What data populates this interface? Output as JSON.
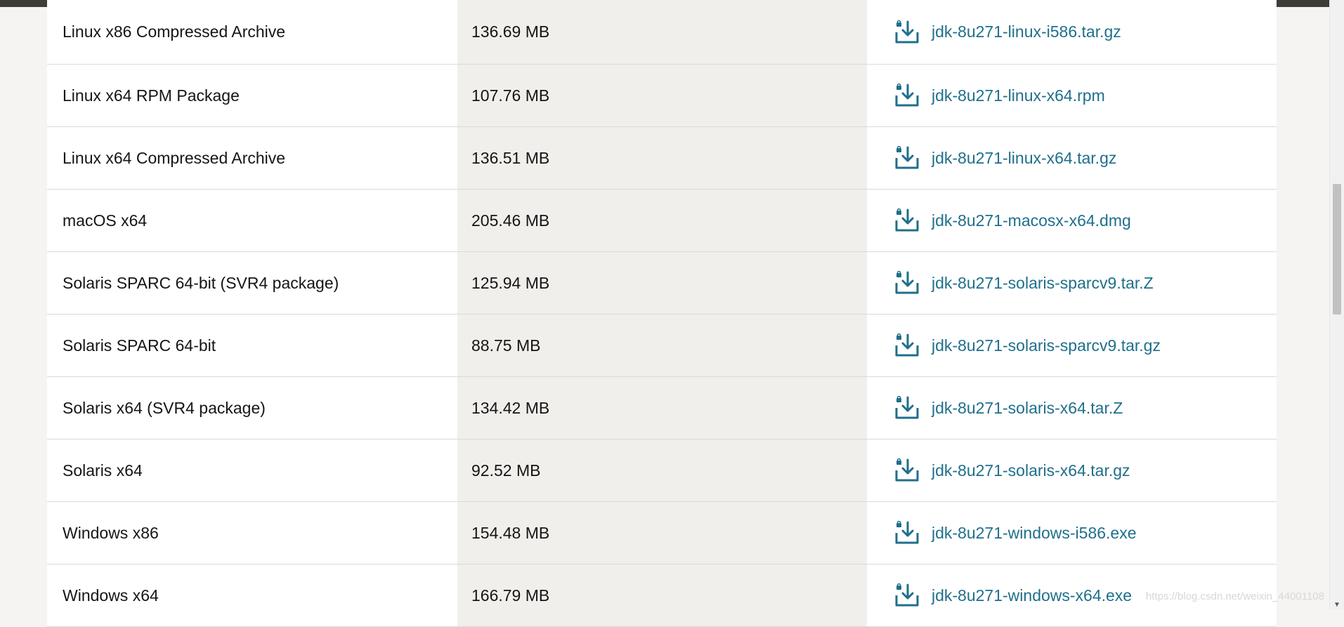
{
  "rows": [
    {
      "product": "Linux x86 Compressed Archive",
      "size": "136.69 MB",
      "file": "jdk-8u271-linux-i586.tar.gz"
    },
    {
      "product": "Linux x64 RPM Package",
      "size": "107.76 MB",
      "file": "jdk-8u271-linux-x64.rpm"
    },
    {
      "product": "Linux x64 Compressed Archive",
      "size": "136.51 MB",
      "file": "jdk-8u271-linux-x64.tar.gz"
    },
    {
      "product": "macOS x64",
      "size": "205.46 MB",
      "file": "jdk-8u271-macosx-x64.dmg"
    },
    {
      "product": "Solaris SPARC 64-bit (SVR4 package)",
      "size": "125.94 MB",
      "file": "jdk-8u271-solaris-sparcv9.tar.Z"
    },
    {
      "product": "Solaris SPARC 64-bit",
      "size": "88.75 MB",
      "file": "jdk-8u271-solaris-sparcv9.tar.gz"
    },
    {
      "product": "Solaris x64 (SVR4 package)",
      "size": "134.42 MB",
      "file": "jdk-8u271-solaris-x64.tar.Z"
    },
    {
      "product": "Solaris x64",
      "size": "92.52 MB",
      "file": "jdk-8u271-solaris-x64.tar.gz"
    },
    {
      "product": "Windows x86",
      "size": "154.48 MB",
      "file": "jdk-8u271-windows-i586.exe"
    },
    {
      "product": "Windows x64",
      "size": "166.79 MB",
      "file": "jdk-8u271-windows-x64.exe"
    }
  ],
  "icons": {
    "download": "download-lock-icon"
  },
  "colors": {
    "link": "#1f6f8b",
    "size_column_bg": "#f1efec",
    "top_bar": "#3f3d38"
  },
  "watermark": "https://blog.csdn.net/weixin_44001108"
}
